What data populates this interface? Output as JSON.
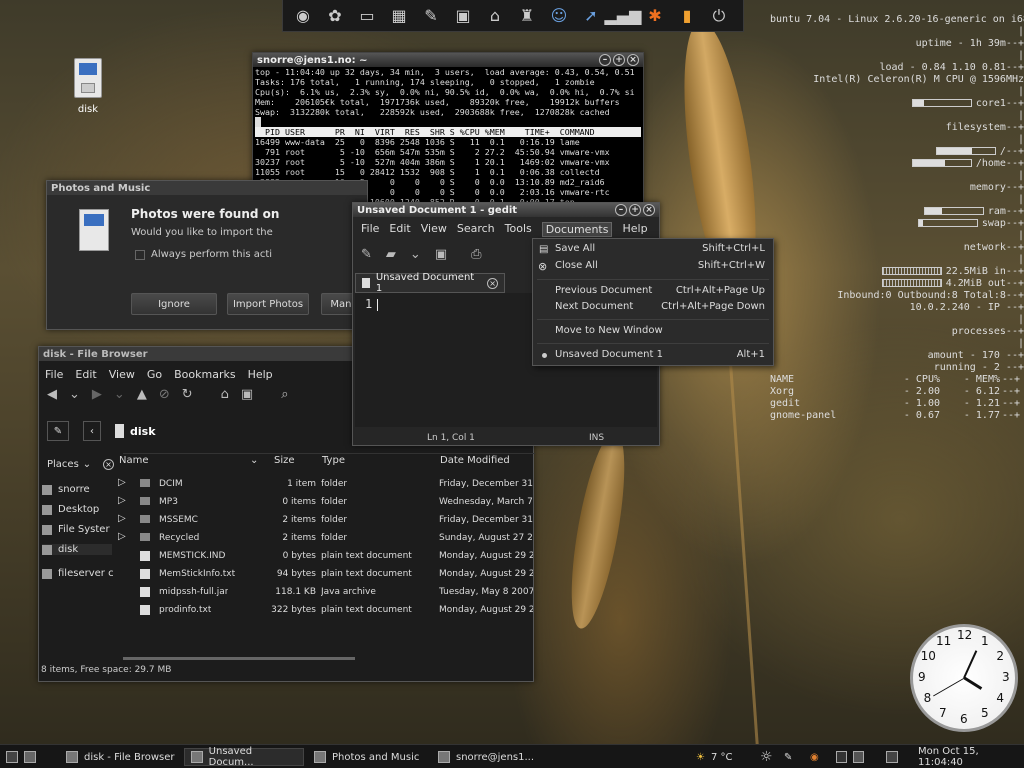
{
  "desktop": {
    "disk_icon_label": "disk"
  },
  "conky": {
    "lines": [
      "buntu 7.04 - Linux 2.6.20-16-generic on i686",
      "|",
      "uptime - 1h 39m--+",
      "|",
      "load - 0.84 1.10 0.81--+",
      "Intel(R) Celeron(R) M CPU @ 1596MHz",
      "|",
      "core1--+",
      "|",
      "filesystem--+",
      "|",
      "/--+",
      "/home--+",
      "|",
      "memory--+",
      "|",
      "ram--+",
      "swap--+",
      "|",
      "network--+",
      "|",
      "22.5MiB in--+",
      "4.2MiB out--+",
      "Inbound:0 Outbound:8 Total:8--+",
      "10.0.2.240 - IP --+",
      "|",
      "processes--+",
      "|",
      "amount - 170 --+",
      "running - 2 --+"
    ],
    "proc_table": [
      [
        "NAME",
        "- CPU%",
        "- MEM%",
        "--+"
      ],
      [
        "Xorg",
        "- 2.00",
        "- 6.12",
        "--+"
      ],
      [
        "gedit",
        "- 1.00",
        "- 1.21",
        "--+"
      ],
      [
        "gnome-panel",
        "- 0.67",
        "- 1.77",
        "--+"
      ]
    ]
  },
  "terminal": {
    "title": "snorre@jens1.no: ~",
    "header_lines": [
      "top - 11:04:40 up 32 days, 34 min,  3 users,  load average: 0.43, 0.54, 0.51",
      "Tasks: 176 total,   1 running, 174 sleeping,   0 stopped,   1 zombie",
      "Cpu(s):  6.1% us,  2.3% sy,  0.0% ni, 90.5% id,  0.0% wa,  0.0% hi,  0.7% si",
      "Mem:    206105€k total,  1971736k used,    89320k free,    19912k buffers",
      "Swap:  3132280k total,   228592k used,  2903688k free,  1270828k cached"
    ],
    "table_header": "  PID USER      PR  NI  VIRT  RES  SHR S %CPU %MEM    TIME+  COMMAND",
    "rows": [
      "16499 www-data  25   0  8396 2548 1036 S   11  0.1   0:16.19 lame",
      "  791 root       5 -10  656m 547m 535m S    2 27.2  45:50.94 vmware-vmx",
      "30237 root       5 -10  527m 404m 386m S    1 20.1   1469:02 vmware-vmx",
      "11055 root      15   0 28412 1532  908 S    1  0.1   0:06.38 collectd",
      " 3882 root      10  -5     0    0    0 S    0  0.0  13:10.89 md2_raid6",
      "  818 root       0 -20     0    0    0 S    0  0.0   2:03.16 vmware-rtc",
      "16751 snorre    16   0 10600 1240  852 R    0  0.1   0:00.17 top",
      "    1 root      16   0  2944  620  524 S    0  0.0   0:01.14 init",
      "    2 root      RT",
      "    3 root      34",
      "    4 root      RT",
      "    5 root      RT",
      "    6 root      34",
      "    7 root      RT",
      "    8 root      10"
    ]
  },
  "photos_dialog": {
    "title": "Photos and Music",
    "heading": "Photos were found on",
    "body": "Would you like to import the",
    "checkbox": "Always perform this acti",
    "buttons": [
      "Ignore",
      "Import Photos",
      "Mana"
    ]
  },
  "file_browser": {
    "title": "disk - File Browser",
    "menu": [
      "File",
      "Edit",
      "View",
      "Go",
      "Bookmarks",
      "Help"
    ],
    "location": "disk",
    "places_label": "Places",
    "places": [
      "snorre",
      "Desktop",
      "File Syster",
      "disk",
      "fileserver c"
    ],
    "columns": [
      "Name",
      "Size",
      "Type",
      "Date Modified"
    ],
    "rows": [
      {
        "name": "DCIM",
        "size": "1 item",
        "type": "folder",
        "date": "Friday, December 31 1",
        "folder": true
      },
      {
        "name": "MP3",
        "size": "0 items",
        "type": "folder",
        "date": "Wednesday, March 7 2",
        "folder": true
      },
      {
        "name": "MSSEMC",
        "size": "2 items",
        "type": "folder",
        "date": "Friday, December 31 1",
        "folder": true
      },
      {
        "name": "Recycled",
        "size": "2 items",
        "type": "folder",
        "date": "Sunday, August 27 200",
        "folder": true
      },
      {
        "name": "MEMSTICK.IND",
        "size": "0 bytes",
        "type": "plain text document",
        "date": "Monday, August 29 200",
        "folder": false
      },
      {
        "name": "MemStickInfo.txt",
        "size": "94 bytes",
        "type": "plain text document",
        "date": "Monday, August 29 200",
        "folder": false
      },
      {
        "name": "midpssh-full.jar",
        "size": "118.1 KB",
        "type": "Java archive",
        "date": "Tuesday, May 8 2007",
        "folder": false
      },
      {
        "name": "prodinfo.txt",
        "size": "322 bytes",
        "type": "plain text document",
        "date": "Monday, August 29 200",
        "folder": false
      }
    ],
    "status": "8 items, Free space: 29.7 MB"
  },
  "gedit": {
    "title": "Unsaved Document 1 - gedit",
    "menu": [
      "File",
      "Edit",
      "View",
      "Search",
      "Tools",
      "Documents",
      "Help"
    ],
    "tab": "Unsaved Document 1",
    "line_number": "1",
    "status_pos": "Ln 1, Col 1",
    "status_mode": "INS"
  },
  "documents_menu": {
    "items": [
      {
        "label": "Save All",
        "shortcut": "Shift+Ctrl+L"
      },
      {
        "label": "Close All",
        "shortcut": "Shift+Ctrl+W"
      },
      {
        "label": "Previous Document",
        "shortcut": "Ctrl+Alt+Page Up"
      },
      {
        "label": "Next Document",
        "shortcut": "Ctrl+Alt+Page Down"
      },
      {
        "label": "Move to New Window",
        "shortcut": ""
      },
      {
        "label": "Unsaved Document 1",
        "shortcut": "Alt+1"
      }
    ]
  },
  "taskbar": {
    "tasks": [
      "disk - File Browser",
      "Unsaved Docum...",
      "Photos and Music",
      "snorre@jens1..."
    ],
    "weather": "7 °C",
    "datetime": "Mon Oct 15, 11:04:40"
  },
  "clock": {
    "numbers": [
      "12",
      "1",
      "2",
      "3",
      "4",
      "5",
      "6",
      "7",
      "8",
      "9",
      "10",
      "11"
    ]
  },
  "colors": {
    "panel": "#161616",
    "window": "#1e1e1e",
    "text": "#dddddd"
  }
}
